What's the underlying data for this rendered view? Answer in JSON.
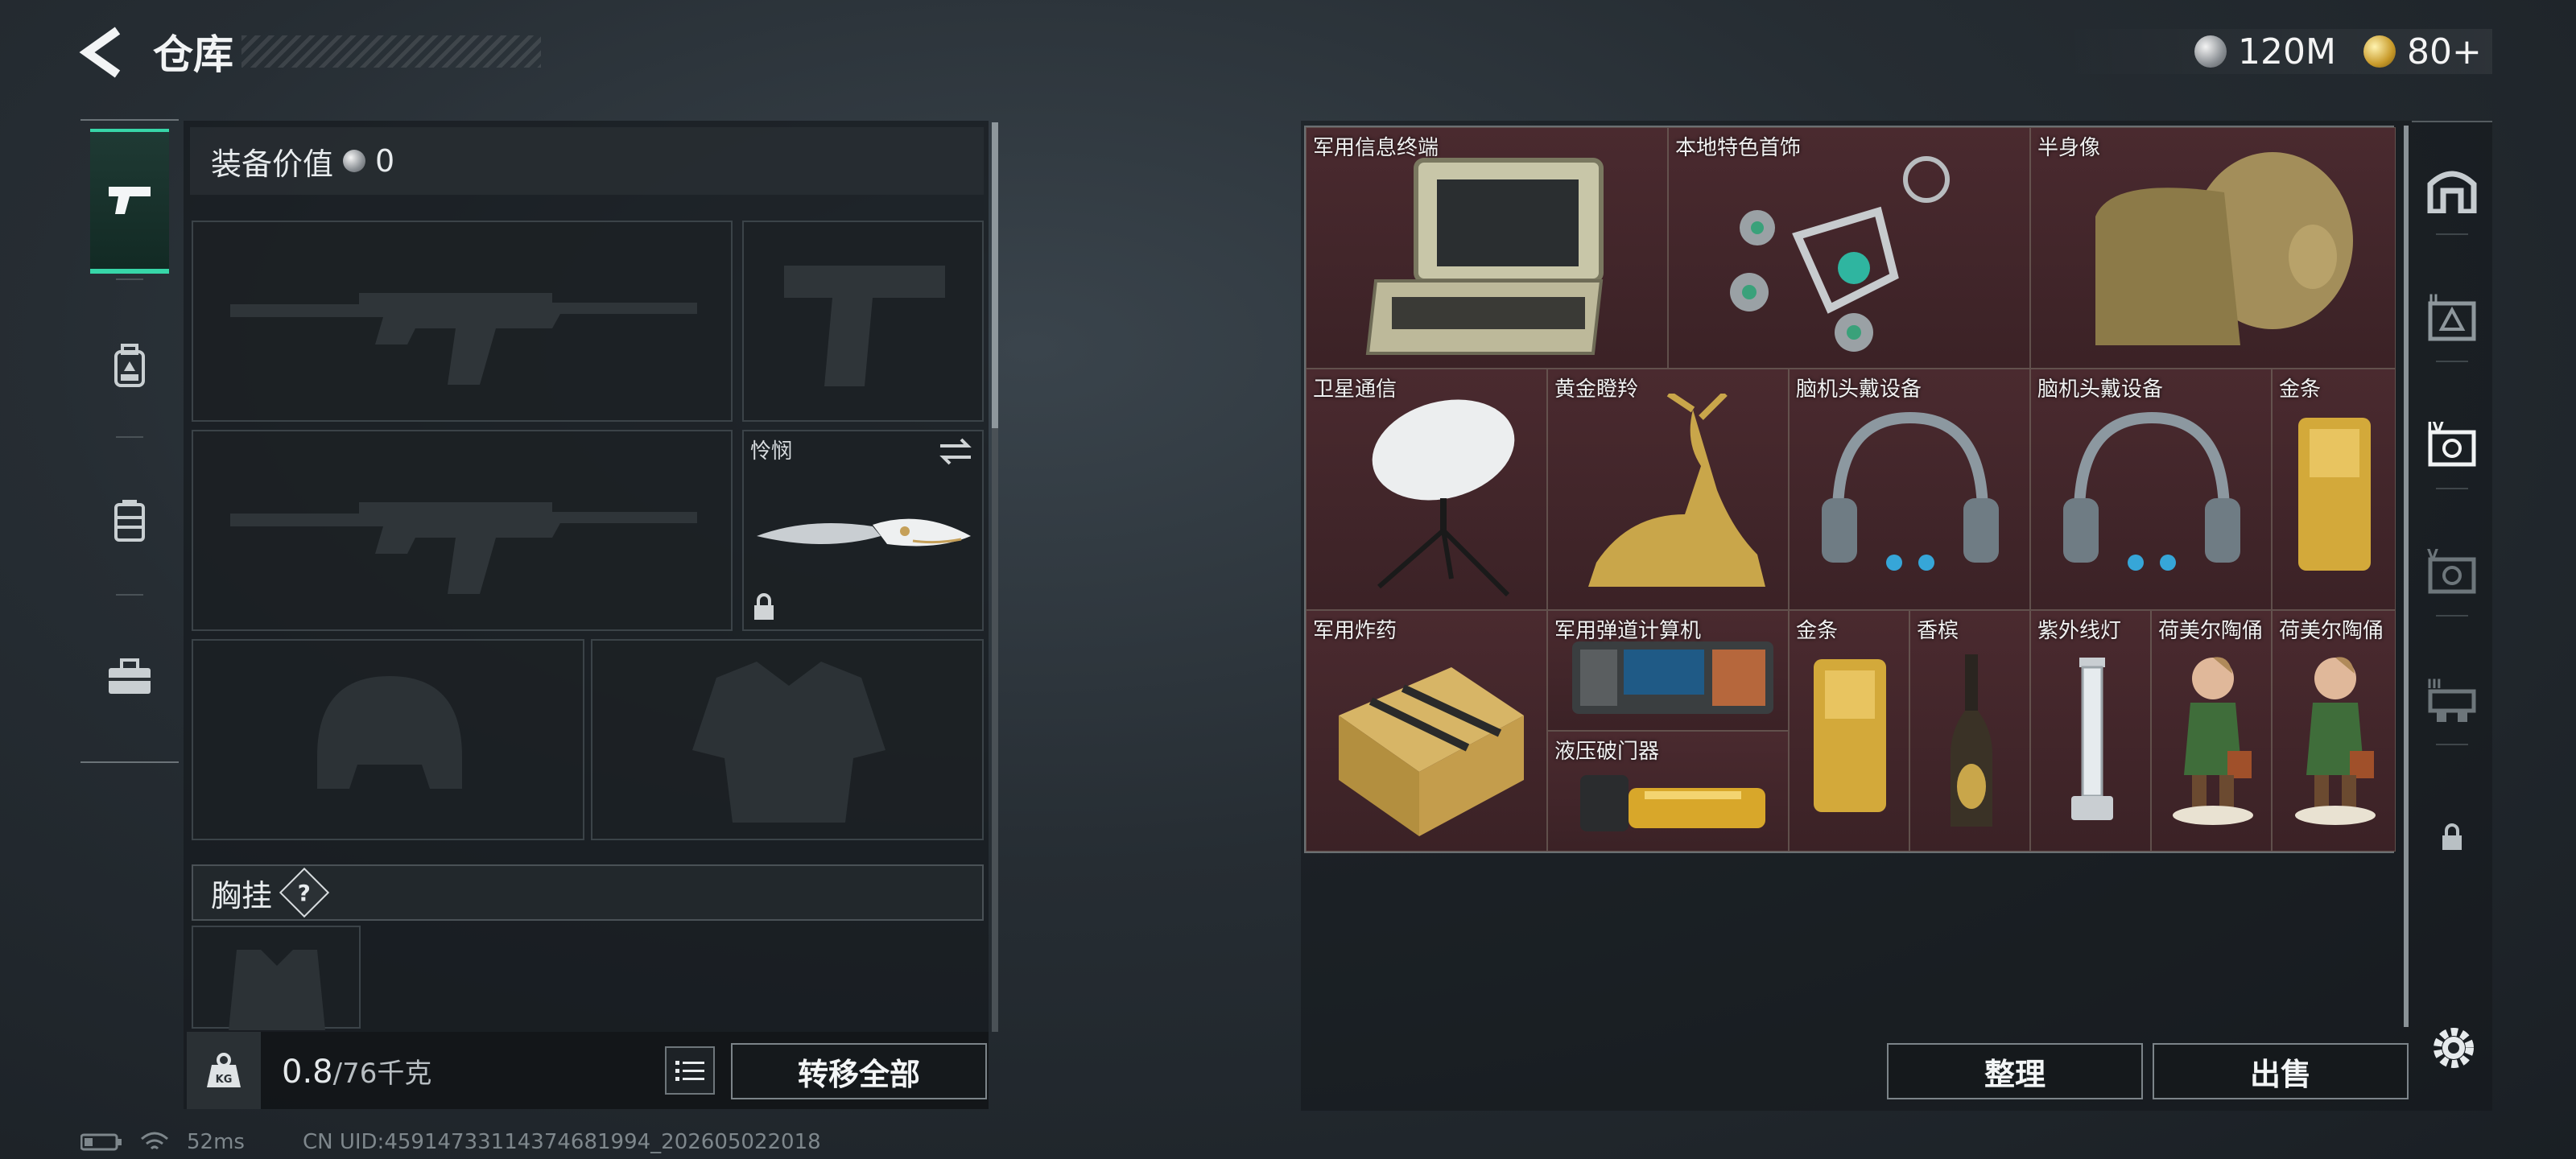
{
  "header": {
    "title": "仓库"
  },
  "currency": [
    {
      "icon": "silver-coin-icon",
      "value": "120M"
    },
    {
      "icon": "gold-coin-icon",
      "value": "80+"
    }
  ],
  "left_nav": [
    {
      "name": "weapons",
      "icon": "pistol-icon",
      "active": true
    },
    {
      "name": "backpack",
      "icon": "backpack-icon",
      "active": false
    },
    {
      "name": "armor-vest",
      "icon": "vest-icon",
      "active": false
    },
    {
      "name": "case",
      "icon": "briefcase-icon",
      "active": false
    }
  ],
  "equipment": {
    "value_label": "装备价值",
    "value": "0",
    "melee_label": "怜悯",
    "chest_rig_label": "胸挂",
    "help": "?"
  },
  "weight": {
    "current": "0.8",
    "max": "/76千克",
    "icon": "kg-weight-icon"
  },
  "buttons": {
    "transfer_all": "转移全部",
    "sort": "整理",
    "sell": "出售"
  },
  "storage_items": [
    {
      "name": "军用信息终端",
      "rarity": "red"
    },
    {
      "name": "本地特色首饰",
      "rarity": "red"
    },
    {
      "name": "半身像",
      "rarity": "red"
    },
    {
      "name": "卫星通信",
      "rarity": "red"
    },
    {
      "name": "黄金瞪羚",
      "rarity": "red"
    },
    {
      "name": "脑机头戴设备",
      "rarity": "red"
    },
    {
      "name": "脑机头戴设备",
      "rarity": "red"
    },
    {
      "name": "金条",
      "rarity": "red"
    },
    {
      "name": "军用炸药",
      "rarity": "red"
    },
    {
      "name": "军用弹道计算机",
      "rarity": "red"
    },
    {
      "name": "液压破门器",
      "rarity": "red"
    },
    {
      "name": "金条",
      "rarity": "red"
    },
    {
      "name": "香槟",
      "rarity": "red"
    },
    {
      "name": "紫外线灯",
      "rarity": "red"
    },
    {
      "name": "荷美尔陶俑",
      "rarity": "red"
    },
    {
      "name": "荷美尔陶俑",
      "rarity": "red"
    }
  ],
  "right_nav": [
    "storage-home-icon",
    "tier-2-icon",
    "tier-4-icon",
    "tier-5-icon",
    "tier-3-icon",
    "lock-icon"
  ],
  "status": {
    "ping": "52ms",
    "uid": "CN UID:4591473311437468199​4_202605022018"
  },
  "colors": {
    "accent": "#37d6a8",
    "red_rarity": "#4a2a2f",
    "gold_rarity": "#463c30"
  }
}
